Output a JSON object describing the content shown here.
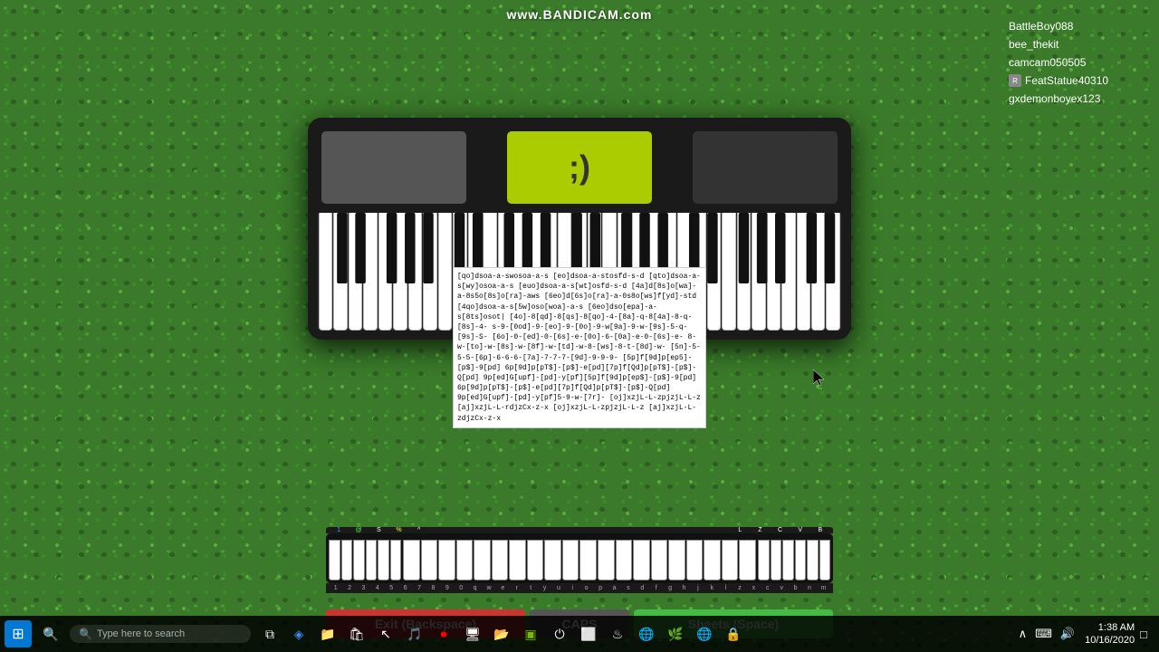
{
  "watermark": "www.BANDICAM.com",
  "display": {
    "emoticon": ";)"
  },
  "chat": {
    "users": [
      {
        "name": "BattleBoy088",
        "icon": ""
      },
      {
        "name": "bee_thekit",
        "icon": ""
      },
      {
        "name": "camcam050505",
        "icon": ""
      },
      {
        "name": "FeatStatue40310",
        "icon": "R"
      },
      {
        "name": "gxdemonboyex123",
        "icon": ""
      }
    ]
  },
  "sheet_text": "[qo]dsoa-a-swosoa-a-s\n[eo]dsoa-a-stosfd-s-d\n[qto]dsoa-a-s[wy]osoa-a-s\n[euo]dsoa-a-s[wt]osfd-s-d\n[4a]d[8s]o[wa]-a-8s5o[8s]o[ra]-aws\n[6eo]d[6s]o[ra]-a-0s8o[ws]f[yd]-std\n[4qo]dsoa-a-s[5w]oso[woa]-a-s\n[6eo]dso[epa]-a-s[8ts]osot|\n[4o]-8[qd]-8[qs]-8[qo]-4-[8a]-q-8[4a]-8-q-[8s]-4-\ns-9-[0od]-9-[eo]-9-[0o]-9-w[9a]-9-w-[9s]-5-q-[9s]-S-\n[6o]-0-[ed]-0-[6s]-e-[0o]-6-[0a]-e-0-[6s]-e-\n8-w-[to]-w-[8s]-w-[8f]-w-[td]-w-8-[ws]-8-t-[8d]-w-\n[5n]-5-5-5-[6p]-6-6-6-[7a]-7-7-7-[9d]-9-9-9-\n[5p]f[9d]p[ep5]-[p$]-9[pd]\n6p[9d]p[pT$]-[p$]-e[pd][7p]f[Qd]p[pT$]-[p$]-Q[pd]\n9p[ed]G[upf]-[pd]-y[pf][5p]f[9d]p[ep$]-[p$]-9[pd]\n6p[9d]p[pT$]-[p$]-e[pd][7p]f[Qd]p[pT$]-[p$]-Q[pd]\n9p[ed]G[upf]-[pd]-y[pf]5-9-w-[7r]-\n[oj]xzjL-L-zpjzjL-L-z\n[aj]xzjL-L-rdjzCx-z-x\n[oj]xzjL-L-zpjzjL-L-z\n[aj]xzjL-L-zdjzCx-z-x",
  "bottom_keys": {
    "labels_left": [
      "1",
      "@",
      "S",
      "%",
      "^"
    ],
    "keys_right": [
      "L",
      "Z",
      "C",
      "V",
      "B"
    ],
    "num_row": [
      "1",
      "2",
      "3",
      "4",
      "5",
      "6",
      "7",
      "8",
      "9",
      "0",
      "q",
      "w",
      "e",
      "r",
      "t",
      "y",
      "u",
      "i",
      "o",
      "p",
      "a",
      "s",
      "d",
      "f",
      "g",
      "h",
      "j",
      "k",
      "l",
      "z",
      "x",
      "c",
      "v",
      "b",
      "n",
      "m"
    ]
  },
  "buttons": {
    "exit": "Exit (Backspace)",
    "caps": "CAPS",
    "sheets": "Sheets (Space)"
  },
  "taskbar": {
    "search_placeholder": "Type here to search",
    "clock": "1:38 AM",
    "date": "10/16/2020"
  }
}
